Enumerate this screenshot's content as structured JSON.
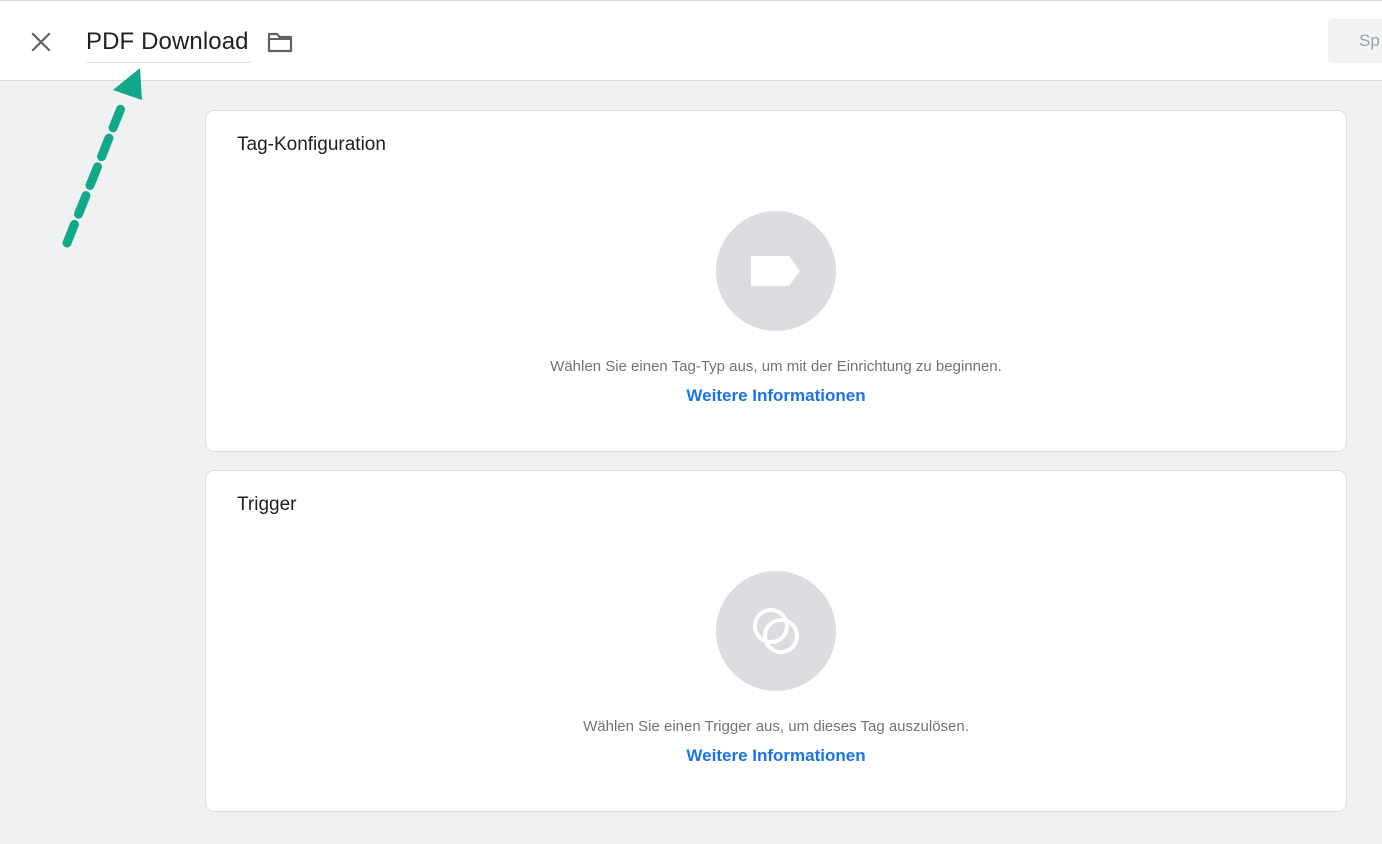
{
  "header": {
    "title": "PDF Download",
    "close_icon": "close-icon",
    "folder_icon": "folder-icon",
    "save_label": "Sp"
  },
  "cards": {
    "tag_config": {
      "title": "Tag-Konfiguration",
      "icon": "tag-icon",
      "hint": "Wählen Sie einen Tag-Typ aus, um mit der Einrichtung zu beginnen.",
      "link": "Weitere Informationen"
    },
    "trigger": {
      "title": "Trigger",
      "icon": "trigger-icon",
      "hint": "Wählen Sie einen Trigger aus, um dieses Tag auszulösen.",
      "link": "Weitere Informationen"
    }
  },
  "colors": {
    "background": "#f0f1f3",
    "card": "#ffffff",
    "link": "#1a73e8",
    "placeholder": "#dadce0",
    "annotation_arrow": "#12a98a"
  }
}
